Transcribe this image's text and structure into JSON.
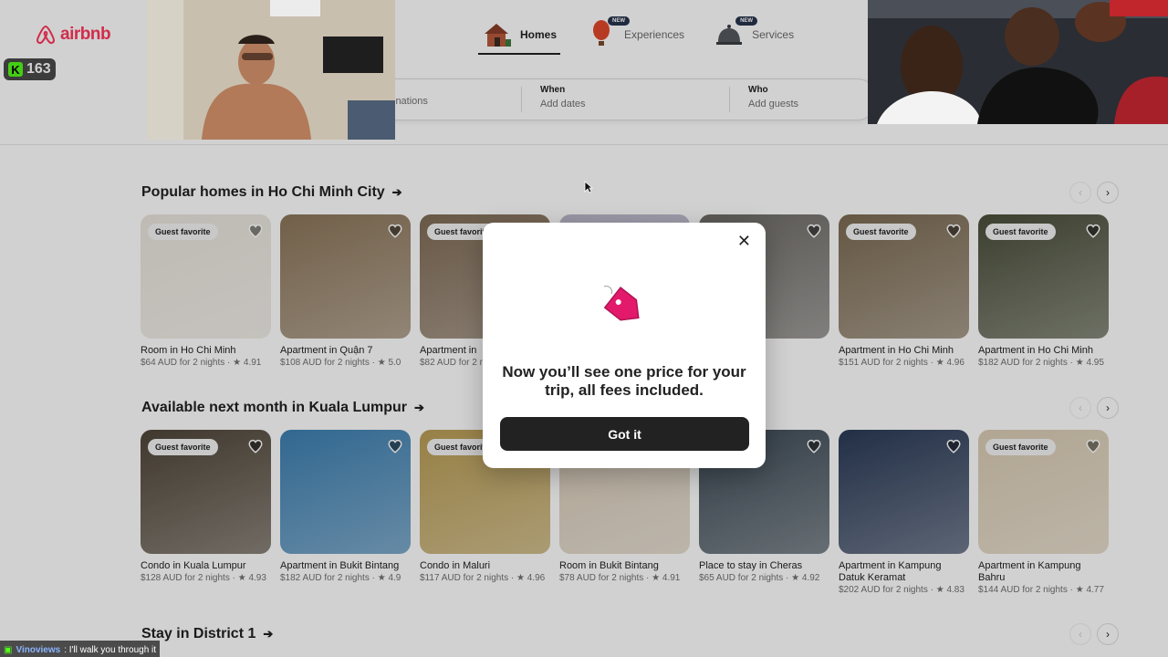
{
  "brand": {
    "name": "airbnb",
    "color": "#ff385c"
  },
  "stream": {
    "badge_count": "163",
    "badge_letter": "K"
  },
  "nav": {
    "tabs": [
      {
        "label": "Homes",
        "active": true,
        "icon": "house-icon"
      },
      {
        "label": "Experiences",
        "new": "NEW",
        "icon": "balloon-icon"
      },
      {
        "label": "Services",
        "new": "NEW",
        "icon": "bell-icon"
      }
    ]
  },
  "search": {
    "where_placeholder": "inations",
    "when_label": "When",
    "when_placeholder": "Add dates",
    "who_label": "Who",
    "who_placeholder": "Add guests"
  },
  "sections": [
    {
      "title": "Popular homes in Ho Chi Minh City",
      "cards": [
        {
          "fav": "Guest favorite",
          "title": "Room in Ho Chi Minh",
          "meta": "$64 AUD for 2 nights · ★ 4.91",
          "color": "#e9e4dc"
        },
        {
          "fav": "",
          "title": "Apartment in Quận 7",
          "meta": "$108 AUD for 2 nights · ★ 5.0",
          "color": "#8b7559"
        },
        {
          "fav": "Guest favorite",
          "title": "Apartment in",
          "meta": "$82 AUD for 2 n",
          "color": "#7f6b55"
        },
        {
          "fav": "",
          "title": "",
          "meta": "",
          "color": "#b9b6c9"
        },
        {
          "fav": "",
          "title": "Quận 3",
          "meta": "ghts · ★ 4.96",
          "color": "#6d6a66"
        },
        {
          "fav": "Guest favorite",
          "title": "Apartment in Ho Chi Minh",
          "meta": "$151 AUD for 2 nights · ★ 4.96",
          "color": "#7b6a52"
        },
        {
          "fav": "Guest favorite",
          "title": "Apartment in Ho Chi Minh",
          "meta": "$182 AUD for 2 nights · ★ 4.95",
          "color": "#4a4e3a"
        }
      ]
    },
    {
      "title": "Available next month in Kuala Lumpur",
      "cards": [
        {
          "fav": "Guest favorite",
          "title": "Condo in Kuala Lumpur",
          "meta": "$128 AUD for 2 nights · ★ 4.93",
          "color": "#4f4538"
        },
        {
          "fav": "",
          "title": "Apartment in Bukit Bintang",
          "meta": "$182 AUD for 2 nights · ★ 4.9",
          "color": "#3d7fb0"
        },
        {
          "fav": "Guest favorite",
          "title": "Condo in Maluri",
          "meta": "$117 AUD for 2 nights · ★ 4.96",
          "color": "#b99d55"
        },
        {
          "fav": "",
          "title": "Room in Bukit Bintang",
          "meta": "$78 AUD for 2 nights · ★ 4.91",
          "color": "#d8cbb8"
        },
        {
          "fav": "",
          "title": "Place to stay in Cheras",
          "meta": "$65 AUD for 2 nights · ★ 4.92",
          "color": "#3d4a55"
        },
        {
          "fav": "",
          "title": "Apartment in Kampung Datuk Keramat",
          "meta": "$202 AUD for 2 nights · ★ 4.83",
          "color": "#2a3a56"
        },
        {
          "fav": "Guest favorite",
          "title": "Apartment in Kampung Bahru",
          "meta": "$144 AUD for 2 nights · ★ 4.77",
          "color": "#d9cbb3"
        }
      ]
    }
  ],
  "section3_title": "Stay in District 1",
  "modal": {
    "message": "Now you’ll see one price for your trip, all fees included.",
    "button": "Got it",
    "close": "✕"
  },
  "chat": {
    "user": "Vinoviews",
    "message": ": I'll walk you through it"
  }
}
